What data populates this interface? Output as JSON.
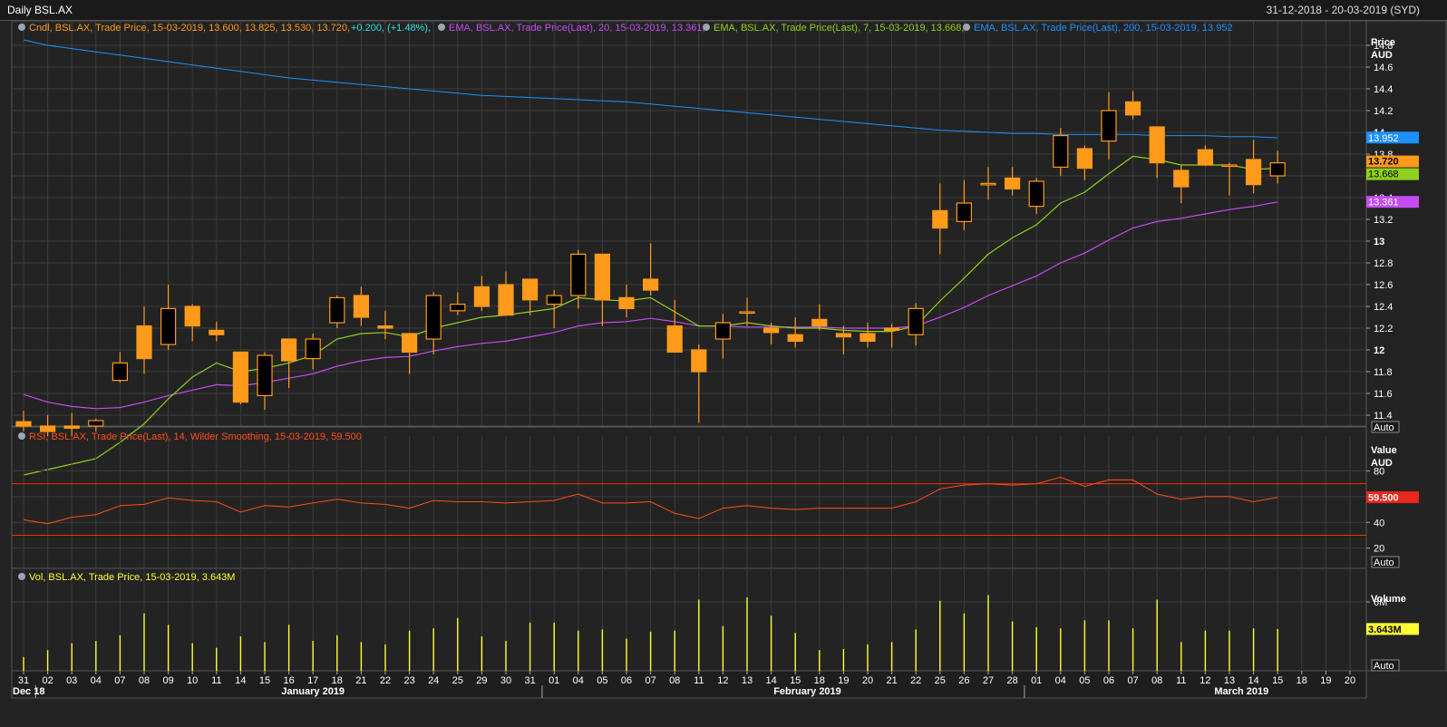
{
  "window": {
    "title": "Daily BSL.AX",
    "date_range": "31-12-2018 - 20-03-2019 (SYD)"
  },
  "legend": {
    "candle": "Cndl, BSL.AX, Trade Price,  15-03-2019, 13.600, 13.825, 13.530, 13.720,",
    "candle_change": "+0.200, (+1.48%),",
    "ema20": "EMA, BSL.AX, Trade Price(Last),  20, 15-03-2019, 13.361,",
    "ema7": "EMA, BSL.AX, Trade Price(Last),  7, 15-03-2019, 13.668,",
    "ema200": "EMA, BSL.AX, Trade Price(Last),  200, 15-03-2019, 13.952",
    "rsi": "RSI, BSL.AX, Trade Price(Last),  14, Wilder Smoothing,  15-03-2019, 59.500",
    "vol": "Vol, BSL.AX, Trade Price,  15-03-2019, 3.643M"
  },
  "axes": {
    "price_title": "Price",
    "price_unit": "AUD",
    "rsi_title": "Value",
    "rsi_unit": "AUD",
    "vol_title": "Volume",
    "auto_label": "Auto"
  },
  "colors": {
    "candle": "#ff9a1a",
    "ema20": "#c44cf2",
    "ema7": "#8fd11c",
    "ema200": "#1e90ff",
    "rsi": "#ff4d1a",
    "rsi_band": "#ff2a00",
    "volume": "#ffff33",
    "background": "#232323",
    "grid": "#3c3c3c"
  },
  "chart_data": [
    {
      "type": "candlestick",
      "title": "Daily BSL.AX",
      "ylabel": "Price AUD",
      "ylim": [
        11.3,
        14.9
      ],
      "y_ticks": [
        11.4,
        11.6,
        11.8,
        12,
        12.2,
        12.4,
        12.6,
        12.8,
        13,
        13.2,
        13.4,
        13.6,
        13.8,
        14,
        14.2,
        14.4,
        14.6,
        14.8
      ],
      "grid": true,
      "x_tick_labels": [
        "31",
        "02",
        "03",
        "04",
        "07",
        "08",
        "09",
        "10",
        "11",
        "14",
        "15",
        "16",
        "17",
        "18",
        "21",
        "22",
        "23",
        "24",
        "25",
        "29",
        "30",
        "31",
        "01",
        "04",
        "05",
        "06",
        "07",
        "08",
        "11",
        "12",
        "13",
        "14",
        "15",
        "18",
        "19",
        "20",
        "21",
        "22",
        "25",
        "26",
        "27",
        "28",
        "01",
        "04",
        "05",
        "06",
        "07",
        "08",
        "11",
        "12",
        "13",
        "14",
        "15",
        "18",
        "19",
        "20"
      ],
      "month_labels": [
        {
          "label": "Dec 18",
          "at": "31"
        },
        {
          "label": "January 2019",
          "at": "16"
        },
        {
          "label": "February 2019",
          "at": "15"
        },
        {
          "label": "March 2019",
          "at": "12"
        }
      ],
      "ohlc": [
        [
          11.34,
          11.44,
          11.25,
          11.3
        ],
        [
          11.3,
          11.4,
          11.2,
          11.25
        ],
        [
          11.3,
          11.42,
          11.2,
          11.28
        ],
        [
          11.3,
          11.37,
          11.25,
          11.35
        ],
        [
          11.72,
          11.98,
          11.7,
          11.88
        ],
        [
          12.22,
          12.4,
          11.78,
          11.92
        ],
        [
          12.05,
          12.6,
          12.0,
          12.38
        ],
        [
          12.4,
          12.42,
          12.08,
          12.22
        ],
        [
          12.18,
          12.26,
          12.08,
          12.14
        ],
        [
          11.98,
          11.98,
          11.5,
          11.52
        ],
        [
          11.58,
          11.98,
          11.45,
          11.95
        ],
        [
          12.1,
          12.1,
          11.65,
          11.9
        ],
        [
          11.92,
          12.15,
          11.82,
          12.1
        ],
        [
          12.25,
          12.5,
          12.2,
          12.48
        ],
        [
          12.5,
          12.58,
          12.22,
          12.3
        ],
        [
          12.22,
          12.36,
          12.1,
          12.2
        ],
        [
          12.15,
          12.15,
          11.78,
          11.98
        ],
        [
          12.1,
          12.53,
          11.96,
          12.5
        ],
        [
          12.36,
          12.53,
          12.32,
          12.42
        ],
        [
          12.58,
          12.68,
          12.36,
          12.4
        ],
        [
          12.6,
          12.72,
          12.38,
          12.32
        ],
        [
          12.65,
          12.65,
          12.32,
          12.46
        ],
        [
          12.42,
          12.55,
          12.2,
          12.5
        ],
        [
          12.5,
          12.92,
          12.38,
          12.88
        ],
        [
          12.88,
          12.88,
          12.22,
          12.46
        ],
        [
          12.48,
          12.6,
          12.3,
          12.38
        ],
        [
          12.65,
          12.98,
          12.5,
          12.55
        ],
        [
          12.22,
          12.46,
          12.0,
          11.98
        ],
        [
          12.0,
          12.05,
          11.33,
          11.8
        ],
        [
          12.1,
          12.33,
          11.92,
          12.25
        ],
        [
          12.35,
          12.48,
          12.22,
          12.35
        ],
        [
          12.2,
          12.25,
          12.05,
          12.16
        ],
        [
          12.14,
          12.3,
          12.02,
          12.08
        ],
        [
          12.28,
          12.42,
          12.18,
          12.22
        ],
        [
          12.15,
          12.22,
          11.96,
          12.12
        ],
        [
          12.15,
          12.25,
          12.02,
          12.08
        ],
        [
          12.2,
          12.24,
          12.02,
          12.18
        ],
        [
          12.14,
          12.43,
          12.04,
          12.38
        ],
        [
          13.28,
          13.53,
          12.88,
          13.12
        ],
        [
          13.18,
          13.56,
          13.1,
          13.35
        ],
        [
          13.52,
          13.68,
          13.38,
          13.53
        ],
        [
          13.58,
          13.68,
          13.42,
          13.48
        ],
        [
          13.32,
          13.58,
          13.25,
          13.55
        ],
        [
          13.68,
          14.04,
          13.6,
          13.97
        ],
        [
          13.85,
          13.88,
          13.56,
          13.67
        ],
        [
          13.92,
          14.37,
          13.75,
          14.2
        ],
        [
          14.28,
          14.38,
          14.12,
          14.16
        ],
        [
          14.05,
          14.05,
          13.58,
          13.72
        ],
        [
          13.65,
          13.7,
          13.35,
          13.5
        ],
        [
          13.84,
          13.88,
          13.69,
          13.7
        ],
        [
          13.7,
          13.72,
          13.42,
          13.7
        ],
        [
          13.75,
          13.93,
          13.44,
          13.52
        ],
        [
          13.6,
          13.83,
          13.53,
          13.72
        ]
      ],
      "ema_200": [
        14.85,
        14.8,
        14.77,
        14.74,
        14.71,
        14.68,
        14.65,
        14.62,
        14.59,
        14.56,
        14.53,
        14.5,
        14.48,
        14.46,
        14.44,
        14.42,
        14.4,
        14.38,
        14.36,
        14.34,
        14.33,
        14.32,
        14.31,
        14.3,
        14.29,
        14.28,
        14.26,
        14.24,
        14.22,
        14.2,
        14.18,
        14.16,
        14.14,
        14.12,
        14.1,
        14.08,
        14.06,
        14.04,
        14.02,
        14.01,
        14.0,
        13.99,
        13.99,
        13.98,
        13.98,
        13.98,
        13.98,
        13.97,
        13.97,
        13.97,
        13.96,
        13.96,
        13.95
      ],
      "ema_7": [
        10.85,
        10.9,
        10.95,
        11.0,
        11.15,
        11.32,
        11.55,
        11.75,
        11.88,
        11.8,
        11.83,
        11.88,
        11.95,
        12.1,
        12.15,
        12.16,
        12.12,
        12.2,
        12.25,
        12.3,
        12.32,
        12.35,
        12.38,
        12.48,
        12.46,
        12.45,
        12.48,
        12.35,
        12.22,
        12.22,
        12.25,
        12.22,
        12.2,
        12.2,
        12.18,
        12.17,
        12.17,
        12.22,
        12.45,
        12.66,
        12.88,
        13.03,
        13.15,
        13.35,
        13.45,
        13.62,
        13.78,
        13.75,
        13.7,
        13.7,
        13.7,
        13.66,
        13.67
      ],
      "ema_20": [
        11.59,
        11.52,
        11.48,
        11.46,
        11.47,
        11.52,
        11.58,
        11.63,
        11.68,
        11.67,
        11.7,
        11.74,
        11.78,
        11.85,
        11.9,
        11.93,
        11.94,
        11.99,
        12.03,
        12.06,
        12.08,
        12.12,
        12.16,
        12.22,
        12.25,
        12.26,
        12.29,
        12.26,
        12.22,
        12.22,
        12.21,
        12.21,
        12.21,
        12.21,
        12.2,
        12.2,
        12.2,
        12.22,
        12.3,
        12.39,
        12.5,
        12.59,
        12.68,
        12.8,
        12.89,
        13.01,
        13.12,
        13.18,
        13.21,
        13.25,
        13.29,
        13.32,
        13.36
      ]
    },
    {
      "type": "line",
      "title": "RSI, BSL.AX, Trade Price(Last), 14, Wilder Smoothing",
      "ylabel": "Value AUD",
      "ylim": [
        5,
        100
      ],
      "y_ticks": [
        20,
        40,
        60,
        80
      ],
      "bands": [
        30,
        70
      ],
      "rsi": [
        42,
        39,
        44,
        46,
        53,
        54,
        59,
        57,
        56,
        48,
        53,
        52,
        55,
        58,
        55,
        54,
        51,
        57,
        56,
        56,
        55,
        56,
        57,
        62,
        55,
        55,
        56,
        47,
        43,
        51,
        53,
        51,
        50,
        51,
        51,
        51,
        51,
        56,
        66,
        69,
        70,
        69,
        70,
        75,
        68,
        73,
        73,
        62,
        58,
        60,
        60,
        56,
        59.5
      ]
    },
    {
      "type": "bar",
      "title": "Vol, BSL.AX, Trade Price",
      "ylabel": "Volume",
      "ylim": [
        0,
        7.5
      ],
      "y_ticks": [
        6
      ],
      "y_tick_label": "6M",
      "volume_m": [
        1.2,
        1.8,
        2.4,
        2.6,
        3.1,
        5.0,
        4.0,
        2.4,
        2.0,
        3.0,
        2.5,
        4.0,
        2.6,
        3.1,
        2.5,
        2.3,
        3.5,
        3.7,
        4.6,
        3.0,
        2.6,
        4.2,
        4.2,
        3.5,
        3.6,
        2.8,
        3.4,
        3.5,
        6.2,
        3.9,
        6.4,
        4.8,
        3.3,
        1.8,
        1.9,
        2.3,
        2.5,
        3.6,
        6.1,
        5.0,
        6.6,
        4.3,
        3.8,
        3.7,
        4.4,
        4.4,
        3.7,
        6.2,
        2.5,
        3.5,
        3.5,
        3.7,
        3.643
      ]
    }
  ],
  "last_values": {
    "ema200": "13.952",
    "close": "13.720",
    "ema7": "13.668",
    "ema20": "13.361",
    "rsi": "59.500",
    "volume": "3.643M"
  }
}
